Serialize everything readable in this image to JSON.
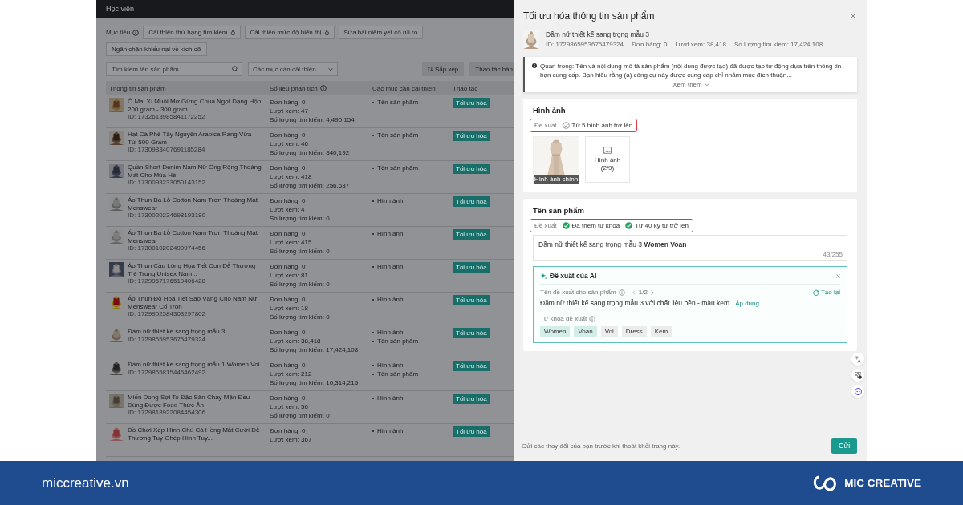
{
  "app": {
    "top_bar": {
      "title": "Học viện"
    },
    "goal_filter": {
      "label": "Mục tiêu",
      "chips": [
        {
          "label": "Cải thiện thứ hạng tìm kiếm",
          "info_icon": true
        },
        {
          "label": "Cải thiện mức độ hiển thị",
          "info_icon": true
        },
        {
          "label": "Sửa bài niêm yết có rủi ro",
          "info_icon": false
        },
        {
          "label": "Ngăn chặn khiếu nại về kích cỡ",
          "info_icon": false
        }
      ]
    },
    "search": {
      "placeholder": "Tìm kiếm tên sản phẩm"
    },
    "issue_filter": {
      "placeholder": "Các mục cần cải thiện"
    },
    "toolbar_buttons": [
      {
        "label": "Sắp xếp",
        "kind": "sort"
      },
      {
        "label": "Thao tác hàn",
        "kind": "plain"
      }
    ],
    "table": {
      "columns": [
        {
          "label": "Thông tin sản phẩm",
          "info_icon": false
        },
        {
          "label": "Số liệu phân tích",
          "info_icon": true
        },
        {
          "label": "Các mục cần cải thiện",
          "info_icon": false
        },
        {
          "label": "Thao tác",
          "info_icon": false
        }
      ],
      "rows": [
        {
          "name": "Ô Mai Xí Muội Mơ Gừng Chua Ngọt Dạng Hộp 200 gram - 300 gram",
          "id": "ID: 1732613985841172252",
          "orders": "Đơn hàng: 0",
          "views": "Lượt xem: 47",
          "searches": "Số lượng tìm kiếm: 4,490,154",
          "issues": [
            "Tên sản phẩm"
          ],
          "action": "Tối ưu hóa"
        },
        {
          "name": "Hạt Cà Phê Tây Nguyên Arabica Rang Vừa - Túi 500 Gram",
          "id": "ID: 1730983407691185284",
          "orders": "Đơn hàng: 0",
          "views": "Lượt xem: 46",
          "searches": "Số lượng tìm kiếm: 840,192",
          "issues": [
            "Tên sản phẩm"
          ],
          "action": "Tối ưu hóa"
        },
        {
          "name": "Quần Short Denim Nam Nữ Ống Rộng Thoáng Mát Cho Mùa Hè",
          "id": "ID: 1730093233050143152",
          "orders": "Đơn hàng: 0",
          "views": "Lượt xem: 418",
          "searches": "Số lượng tìm kiếm: 256,637",
          "issues": [
            "Tên sản phẩm"
          ],
          "action": "Tối ưu hóa"
        },
        {
          "name": "Áo Thun Ba Lỗ Cotton Nam Trơn Thoáng Mát Menswear",
          "id": "ID: 1730020234698193180",
          "orders": "Đơn hàng: 0",
          "views": "Lượt xem: 4",
          "searches": "Số lượng tìm kiếm: 0",
          "issues": [
            "Hình ảnh"
          ],
          "action": "Tối ưu hóa"
        },
        {
          "name": "Áo Thun Ba Lỗ Cotton Nam Trơn Thoáng Mát Menswear",
          "id": "ID: 1730010202490974456",
          "orders": "Đơn hàng: 0",
          "views": "Lượt xem: 415",
          "searches": "Số lượng tìm kiếm: 0",
          "issues": [
            "Hình ảnh"
          ],
          "action": "Tối ưu hóa"
        },
        {
          "name": "Áo Thun Cầu Lông Họa Tiết Con Dễ Thương Trẻ Trung Unisex Nam...",
          "id": "ID: 1729967176519406428",
          "orders": "Đơn hàng: 0",
          "views": "Lượt xem: 81",
          "searches": "Số lượng tìm kiếm: 0",
          "issues": [
            "Hình ảnh"
          ],
          "action": "Tối ưu hóa"
        },
        {
          "name": "Áo Thun Đỏ Họa Tiết Sao Vàng Cho Nam Nữ Menswear Cổ Tròn",
          "id": "ID: 1729902584303297802",
          "orders": "Đơn hàng: 0",
          "views": "Lượt xem: 18",
          "searches": "Số lượng tìm kiếm: 0",
          "issues": [
            "Hình ảnh"
          ],
          "action": "Tối ưu hóa"
        },
        {
          "name": "Đầm nữ thiết kế sang trọng mẫu 3",
          "id": "ID: 1729865953675479324",
          "orders": "Đơn hàng: 0",
          "views": "Lượt xem: 38,418",
          "searches": "Số lượng tìm kiếm: 17,424,108",
          "issues": [
            "Hình ảnh",
            "Tên sản phẩm"
          ],
          "action": "Tối ưu hóa"
        },
        {
          "name": "Đầm nữ thiết kế sang trọng mẫu 1 Women Voi",
          "id": "ID: 1729865815446462492",
          "orders": "Đơn hàng: 0",
          "views": "Lượt xem: 212",
          "searches": "Số lượng tìm kiếm: 10,314,215",
          "issues": [
            "Hình ảnh",
            "Tên sản phẩm"
          ],
          "action": "Tối ưu hóa"
        },
        {
          "name": "Miến Dong Sợi To Đặc Sản Chay Mặn Đều Dùng Được Food Thức Ăn",
          "id": "ID: 1729818922084454306",
          "orders": "Đơn hàng: 0",
          "views": "Lượt xem: 56",
          "searches": "Số lượng tìm kiếm: 0",
          "issues": [
            "Hình ảnh"
          ],
          "action": "Tối ưu hóa"
        },
        {
          "name": "Đồ Chơi Xếp Hình Chú Cá Hồng Mắt Cười Dễ Thương Tuy Ghép Hình Tuy...",
          "orders": "Đơn hàng: 0",
          "views": "Lượt xem: 367",
          "issues": [
            "Hình ảnh"
          ],
          "action": "Tối ưu hóa"
        }
      ]
    }
  },
  "drawer": {
    "title": "Tối ưu hóa thông tin sản phẩm",
    "product": {
      "name": "Đầm nữ thiết kế sang trọng mẫu 3",
      "id": "ID: 1729865953675479324",
      "orders": "Đơn hàng: 0",
      "views": "Lượt xem: 38,418",
      "searches": "Số lượng tìm kiếm: 17,424,108"
    },
    "notice": {
      "text": "Quan trọng: Tên và nội dung mô tả sản phẩm (nội dung được tạo) đã được tạo tự động dựa trên thông tin bạn cung cấp. Bạn hiểu rằng (a) công cụ này được cung cấp chỉ nhằm mục đích thuận...",
      "more": "Xem thêm"
    },
    "images_section": {
      "title": "Hình ảnh",
      "criteria": {
        "label": "Đề xuất",
        "highlighted": true,
        "items": [
          {
            "label": "Từ 5 hình ảnh trở lên",
            "met": false
          }
        ]
      },
      "main_image_caption": "Hình ảnh chính",
      "add_tile": "Hình ảnh (2/9)"
    },
    "name_section": {
      "title": "Tên sản phẩm",
      "criteria": {
        "label": "Đề xuất",
        "highlighted": true,
        "items": [
          {
            "label": "Đã thêm từ khóa",
            "met": true
          },
          {
            "label": "Từ 40 ký tự trở lên",
            "met": true
          }
        ]
      },
      "name_value": "Đầm nữ thiết kế sang trọng mẫu 3 **Women Voan**",
      "counter": "43/255",
      "ai": {
        "title": "Đề xuất của AI",
        "suggestion_label": "Tên đề xuất cho sản phẩm",
        "pager": "1/2",
        "regenerate": "Tạo lại",
        "suggestion": "Đầm nữ thiết kế sang trọng mẫu 3 với chất liệu bền - màu kem",
        "apply": "Áp dụng",
        "keywords_label": "Từ khóa đề xuất",
        "keywords": [
          {
            "label": "Women",
            "added": true
          },
          {
            "label": "Voan",
            "added": true
          },
          {
            "label": "Voi",
            "added": false
          },
          {
            "label": "Dress",
            "added": false
          },
          {
            "label": "Kem",
            "added": false
          }
        ]
      }
    },
    "footer": {
      "note": "Gửi các thay đổi của bạn trước khi thoát khỏi trang này.",
      "submit": "Gửi"
    }
  },
  "banner": {
    "site": "miccreative.vn",
    "brand": "MIC CREATIVE"
  }
}
